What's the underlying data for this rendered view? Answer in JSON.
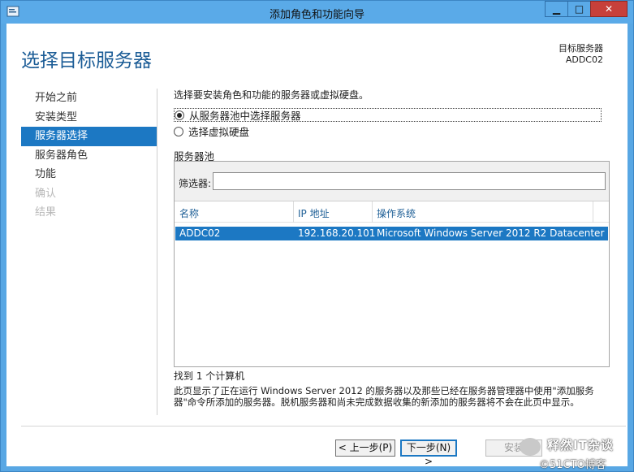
{
  "window": {
    "title": "添加角色和功能向导",
    "min_label": "▁",
    "max_label": "□",
    "close_label": "✕"
  },
  "header": {
    "page_title": "选择目标服务器",
    "dest_label": "目标服务器",
    "dest_value": "ADDC02"
  },
  "nav": {
    "items": [
      {
        "label": "开始之前",
        "state": "normal"
      },
      {
        "label": "安装类型",
        "state": "normal"
      },
      {
        "label": "服务器选择",
        "state": "active"
      },
      {
        "label": "服务器角色",
        "state": "normal"
      },
      {
        "label": "功能",
        "state": "normal"
      },
      {
        "label": "确认",
        "state": "disabled"
      },
      {
        "label": "结果",
        "state": "disabled"
      }
    ]
  },
  "main": {
    "description": "选择要安装角色和功能的服务器或虚拟硬盘。",
    "option_pool": "从服务器池中选择服务器",
    "option_vhd": "选择虚拟硬盘",
    "pool_label": "服务器池",
    "filter_label": "筛选器:",
    "filter_value": "",
    "columns": [
      "名称",
      "IP 地址",
      "操作系统"
    ],
    "rows": [
      {
        "name": "ADDC02",
        "ip": "192.168.20.101",
        "os": "Microsoft Windows Server 2012 R2 Datacenter"
      }
    ],
    "found_text": "找到 1 个计算机",
    "info_line1": "此页显示了正在运行 Windows Server 2012 的服务器以及那些已经在服务器管理器中使用\"添加服务",
    "info_line2": "器\"命令所添加的服务器。脱机服务器和尚未完成数据收集的新添加的服务器将不会在此页中显示。"
  },
  "footer": {
    "prev_label": "< 上一步(P)",
    "next_label": "下一步(N) >",
    "install_label": "安装"
  },
  "watermark": {
    "line1": "释然IT杂谈",
    "line2": "©51CTO博客"
  },
  "colors": {
    "title_bar": "#5aaae8",
    "accent": "#1c78c3",
    "heading": "#1b5c96",
    "close": "#c7403a"
  }
}
